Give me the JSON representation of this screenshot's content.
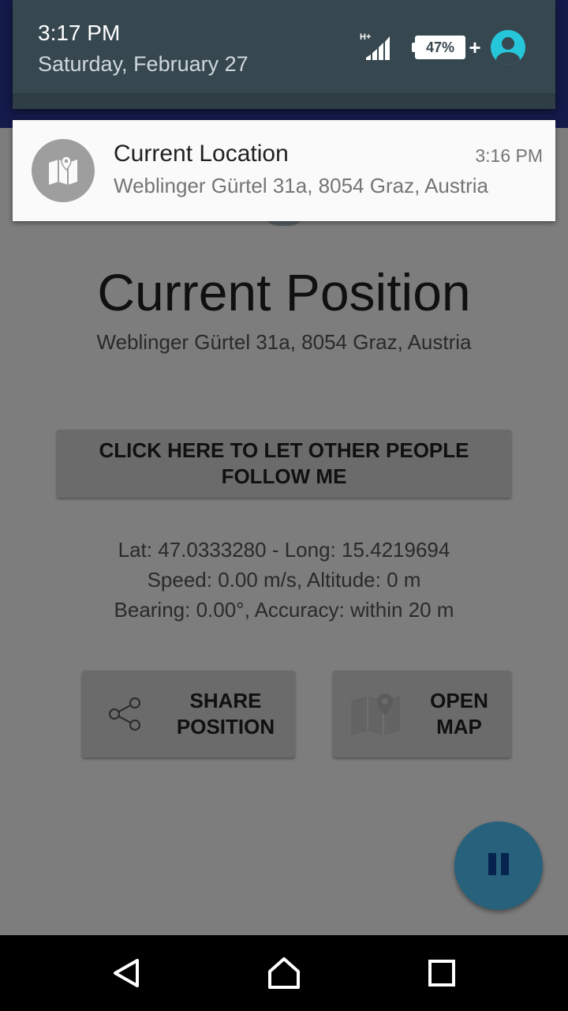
{
  "status": {
    "time": "3:17 PM",
    "date": "Saturday, February 27",
    "network_type": "H+",
    "battery_percent": "47%",
    "icons": [
      "signal-icon",
      "battery-charging-icon",
      "user-icon"
    ]
  },
  "notification": {
    "icon": "map-icon",
    "title": "Current Location",
    "time": "3:16 PM",
    "text": "Weblinger Gürtel 31a, 8054 Graz, Austria"
  },
  "app": {
    "title": "Current Position",
    "address": "Weblinger Gürtel 31a, 8054 Graz, Austria",
    "follow_button": "CLICK HERE TO LET OTHER PEOPLE FOLLOW ME",
    "info_lines": [
      "Lat: 47.0333280 - Long: 15.4219694",
      "Speed: 0.00 m/s, Altitude: 0 m",
      "Bearing: 0.00°, Accuracy: within 20 m"
    ],
    "share_button": [
      "SHARE",
      "POSITION"
    ],
    "map_button": [
      "OPEN",
      "MAP"
    ],
    "fab_icon": "pause-icon"
  },
  "navbar": {
    "icons": [
      "back-icon",
      "home-icon",
      "recents-icon"
    ]
  },
  "colors": {
    "shade": "#37474f",
    "accent": "#26c6da",
    "fab": "#4fc3f7",
    "toolbar": "#283593"
  }
}
